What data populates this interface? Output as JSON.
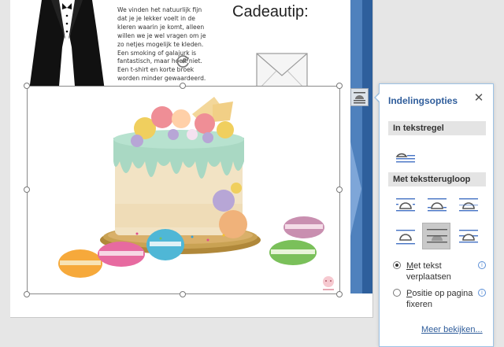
{
  "document": {
    "heading": "Cadeautip:",
    "paragraph_lines": [
      "We vinden het natuurlijk fijn",
      "dat je je lekker voelt in de",
      "kleren waarin je komt, alleen",
      "willen we je wel vragen om je",
      "zo netjes mogelijk te kleden.",
      "Een smoking of galajurk is",
      "fantastisch, maar hoeft niet.",
      "Een t-shirt en korte broek",
      "worden minder gewaardeerd."
    ]
  },
  "layout_panel": {
    "title": "Indelingsopties",
    "close_label": "✕",
    "section_inline": "In tekstregel",
    "section_wrap": "Met tekstterugloop",
    "radio_move_prefix": "M",
    "radio_move_suffix": "et tekst verplaatsen",
    "radio_fix_prefix": "P",
    "radio_fix_suffix": "ositie op pagina fixeren",
    "info_glyph": "i",
    "more_link": "Meer bekijken..."
  },
  "icons": {
    "layout_button": "layout-options-icon",
    "rotate": "rotate-handle-icon",
    "envelope": "envelope-icon",
    "tuxedo": "tuxedo-image",
    "cake": "cake-image"
  },
  "colors": {
    "accent": "#2f5d9b",
    "blue_band": "#4f81bd",
    "panel_border": "#9dc3e6"
  }
}
